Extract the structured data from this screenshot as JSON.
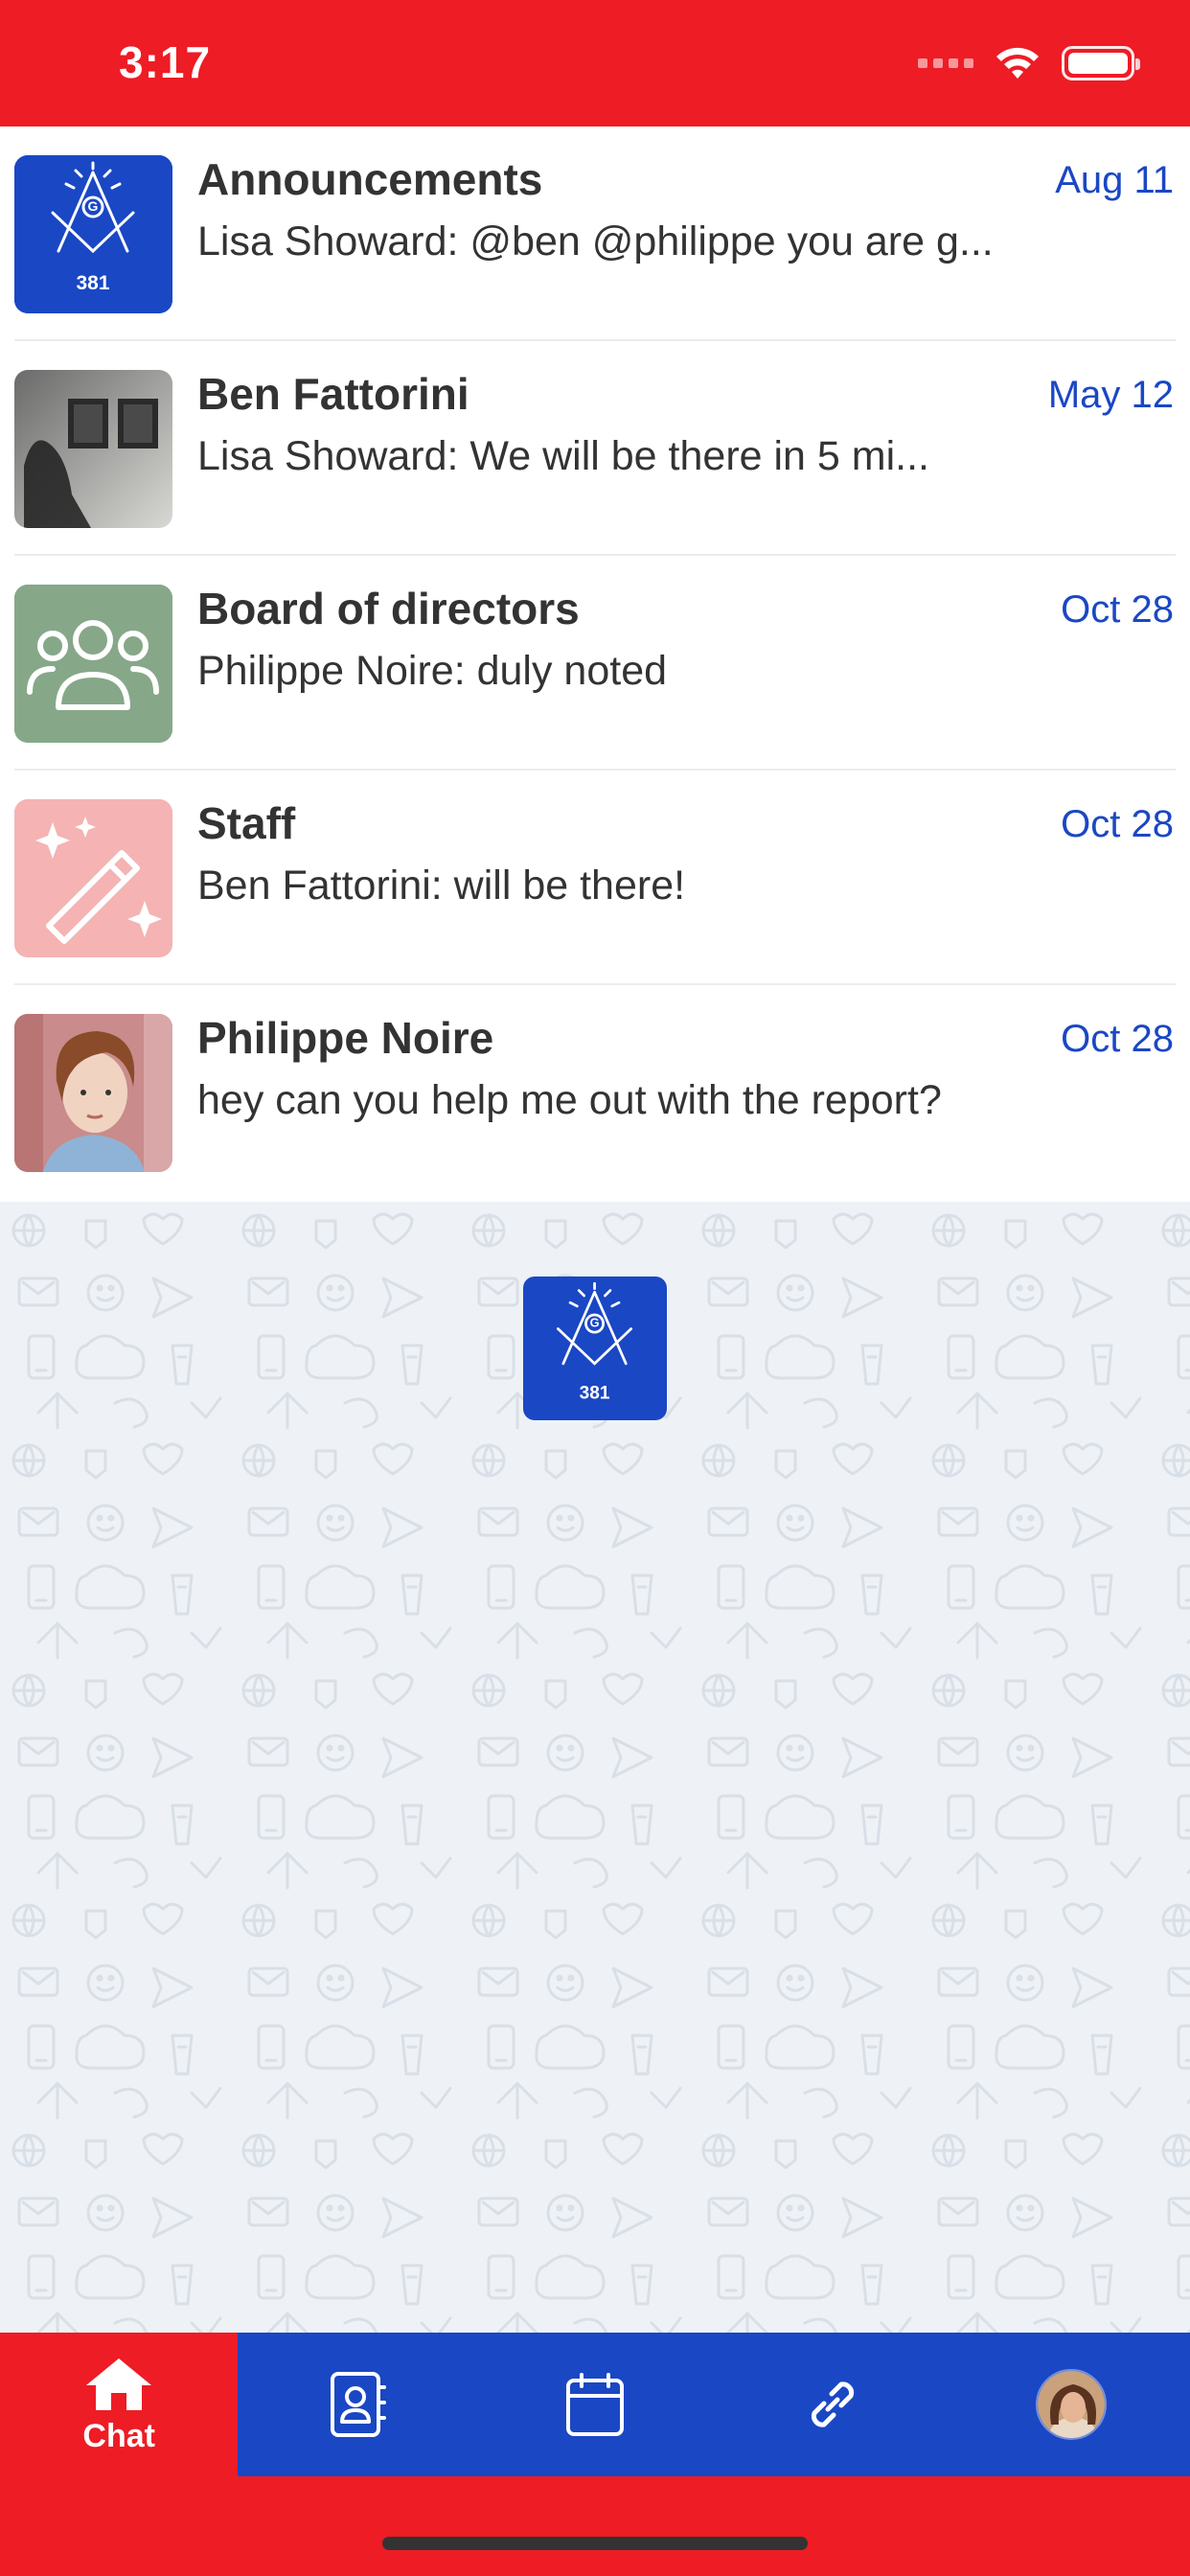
{
  "status_bar": {
    "time": "3:17"
  },
  "chats": [
    {
      "name": "Announcements",
      "date": "Aug 11",
      "preview": "Lisa Showard: @ben @philippe you are g...",
      "avatar": "masonic-logo-icon",
      "badge": "381"
    },
    {
      "name": "Ben Fattorini",
      "date": "May 12",
      "preview": "Lisa Showard: We will be there in 5 mi...",
      "avatar": "photo-person-frames"
    },
    {
      "name": "Board of directors",
      "date": "Oct 28",
      "preview": "Philippe Noire: duly noted",
      "avatar": "group-icon",
      "avatar_color": "#86a888"
    },
    {
      "name": "Staff",
      "date": "Oct 28",
      "preview": "Ben Fattorini: will be there!",
      "avatar": "magic-wand-icon",
      "avatar_color": "#f5b3b3"
    },
    {
      "name": "Philippe Noire",
      "date": "Oct 28",
      "preview": "hey can you help me out with the report?",
      "avatar": "photo-person"
    }
  ],
  "center_logo": {
    "badge": "381"
  },
  "tabs": [
    {
      "label": "Chat",
      "icon": "home-icon",
      "active": true
    },
    {
      "label": "",
      "icon": "contacts-icon",
      "active": false
    },
    {
      "label": "",
      "icon": "calendar-icon",
      "active": false
    },
    {
      "label": "",
      "icon": "link-icon",
      "active": false
    },
    {
      "label": "",
      "icon": "profile-avatar",
      "active": false
    }
  ],
  "colors": {
    "brand_red": "#ee1c25",
    "brand_blue": "#1a47c4",
    "date_blue": "#1a47c4"
  }
}
